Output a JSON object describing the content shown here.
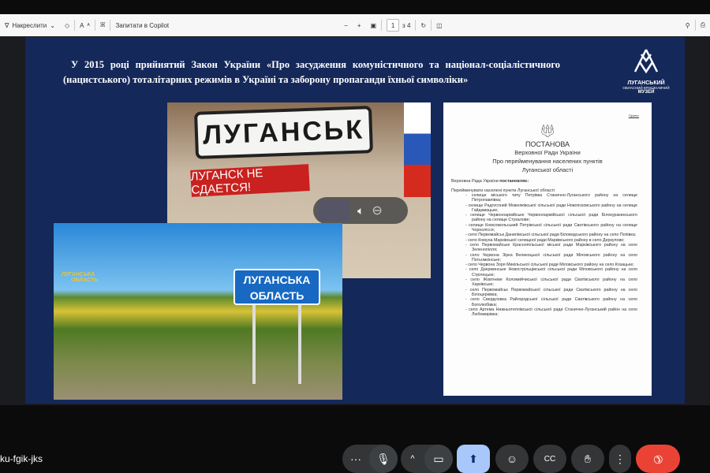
{
  "toolbar": {
    "draw": "Накреслити",
    "ask_copilot": "Запитати в Copilot",
    "page": "1",
    "page_total": "з 4",
    "zoom_out": "−",
    "zoom_in": "+",
    "text_size": "A",
    "read_aloud": "ꕤ"
  },
  "slide": {
    "title": "У 2015 році прийнятий Закон України «Про засудження комуністичного та націонал-соціалістичного (нацистського) тоталітарних режимів в Україні та заборону пропаганди їхньої символіки»",
    "logo": {
      "line1": "ЛУГАНСЬКИЙ",
      "line2": "ОБЛАСНИЙ КРАЄЗНАВЧИЙ",
      "line3": "МУЗЕЙ"
    },
    "photo1": {
      "sign": "ЛУГАНСЬК",
      "banner": "ЛУГАНСК НЕ СДАЕТСЯ!"
    },
    "photo2": {
      "sign_line1": "ЛУГАНСЬКА",
      "sign_line2": "ОБЛАСТЬ",
      "monument_line1": "ЛУГАНСЬКА",
      "monument_line2": "ОБЛАСТЬ"
    },
    "document": {
      "project": "Проект",
      "title": "ПОСТАНОВА",
      "subtitle1": "Верховної Ради України",
      "subtitle2": "Про перейменування населених пунктів",
      "subtitle3": "Луганської області",
      "intro_a": "Верховна Рада України ",
      "intro_b": "постановляє:",
      "lead": "Перейменувати населені пункти Луганської області",
      "items": [
        "селище міського типу Петрівка Станично-Луганського району на селище Петропавлівка;",
        "селище Радгоспний Можняківської сільської ради Новопсковського району на селище Гайдамацьке;",
        "селище Червоноармійське Червоноармійської сільської ради Білокуракинського району на селище Стукалове;",
        "селище Комсомольський Петрівської сільської ради Сватівського району на селище Чорнолісся;",
        "село Первомайськ Данилівської сільської ради Біловодського району на село Попівка;",
        "село Комуна Марківської селищної ради Марківського району в село Деркулове;",
        "село Первомайське Краснопільської міської ради Марківського району на село Зеленопілля;",
        "село Червона Зірка Великоцької сільської ради Міловського району на село Потьомкінське;",
        "село Червона Зоря Микільської сільської ради Міловського району на село Козацьке;",
        "село Дзержинське Новострільцівської сільської ради Міловського району на село Стрілецьке;",
        "село Жовтневе Коломийчиської сільської ради Сватівського району на село Харківське;",
        "село Первомайськ Первомайської сільської ради Сватівського району на село Білоцерківка;",
        "село Свердловка Райгородської сільської ради Сватівського району на село Боголюбівка;",
        "село Артема Нижньотеплівської сільської ради Станично-Луганський район на село Любомирівка;"
      ]
    }
  },
  "meeting": {
    "id": "ku-fgik-jks",
    "more_label": "···",
    "expand_label": "^"
  },
  "colors": {
    "slide_bg": "#15285a",
    "end_call": "#ea4335",
    "present_active": "#a8c7fa"
  }
}
